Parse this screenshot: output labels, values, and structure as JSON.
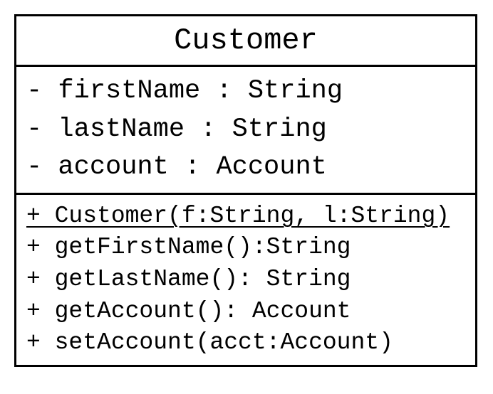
{
  "class": {
    "name": "Customer",
    "attributes": [
      {
        "text": "- firstName : String"
      },
      {
        "text": "- lastName : String"
      },
      {
        "text": "- account : Account"
      }
    ],
    "methods": [
      {
        "text": "+ Customer(f:String, l:String)",
        "underlined": true
      },
      {
        "text": "+ getFirstName():String",
        "underlined": false
      },
      {
        "text": "+ getLastName(): String",
        "underlined": false
      },
      {
        "text": "+ getAccount(): Account",
        "underlined": false
      },
      {
        "text": "+ setAccount(acct:Account)",
        "underlined": false
      }
    ]
  }
}
